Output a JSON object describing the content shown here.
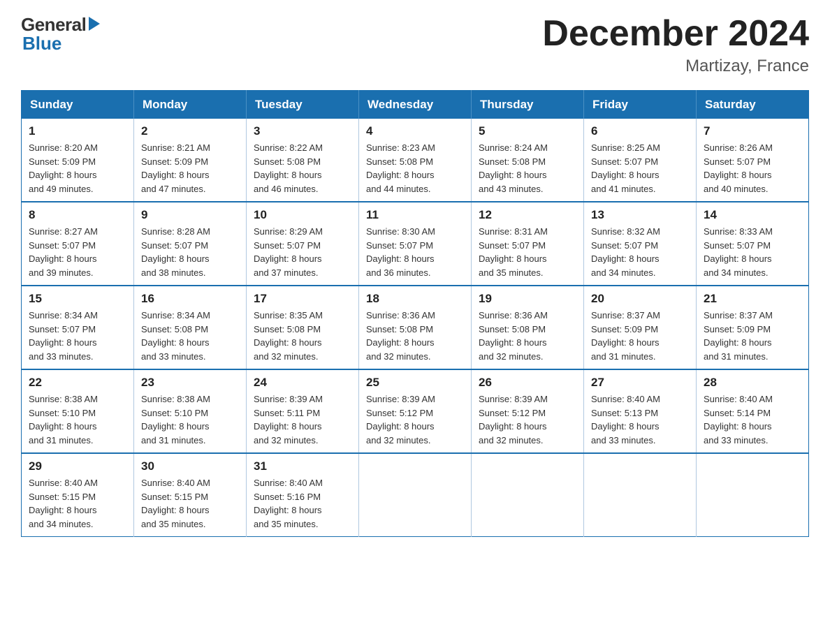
{
  "logo": {
    "general": "General",
    "blue": "Blue"
  },
  "title": "December 2024",
  "subtitle": "Martizay, France",
  "headers": [
    "Sunday",
    "Monday",
    "Tuesday",
    "Wednesday",
    "Thursday",
    "Friday",
    "Saturday"
  ],
  "weeks": [
    [
      {
        "day": "1",
        "sunrise": "8:20 AM",
        "sunset": "5:09 PM",
        "daylight": "8 hours and 49 minutes."
      },
      {
        "day": "2",
        "sunrise": "8:21 AM",
        "sunset": "5:09 PM",
        "daylight": "8 hours and 47 minutes."
      },
      {
        "day": "3",
        "sunrise": "8:22 AM",
        "sunset": "5:08 PM",
        "daylight": "8 hours and 46 minutes."
      },
      {
        "day": "4",
        "sunrise": "8:23 AM",
        "sunset": "5:08 PM",
        "daylight": "8 hours and 44 minutes."
      },
      {
        "day": "5",
        "sunrise": "8:24 AM",
        "sunset": "5:08 PM",
        "daylight": "8 hours and 43 minutes."
      },
      {
        "day": "6",
        "sunrise": "8:25 AM",
        "sunset": "5:07 PM",
        "daylight": "8 hours and 41 minutes."
      },
      {
        "day": "7",
        "sunrise": "8:26 AM",
        "sunset": "5:07 PM",
        "daylight": "8 hours and 40 minutes."
      }
    ],
    [
      {
        "day": "8",
        "sunrise": "8:27 AM",
        "sunset": "5:07 PM",
        "daylight": "8 hours and 39 minutes."
      },
      {
        "day": "9",
        "sunrise": "8:28 AM",
        "sunset": "5:07 PM",
        "daylight": "8 hours and 38 minutes."
      },
      {
        "day": "10",
        "sunrise": "8:29 AM",
        "sunset": "5:07 PM",
        "daylight": "8 hours and 37 minutes."
      },
      {
        "day": "11",
        "sunrise": "8:30 AM",
        "sunset": "5:07 PM",
        "daylight": "8 hours and 36 minutes."
      },
      {
        "day": "12",
        "sunrise": "8:31 AM",
        "sunset": "5:07 PM",
        "daylight": "8 hours and 35 minutes."
      },
      {
        "day": "13",
        "sunrise": "8:32 AM",
        "sunset": "5:07 PM",
        "daylight": "8 hours and 34 minutes."
      },
      {
        "day": "14",
        "sunrise": "8:33 AM",
        "sunset": "5:07 PM",
        "daylight": "8 hours and 34 minutes."
      }
    ],
    [
      {
        "day": "15",
        "sunrise": "8:34 AM",
        "sunset": "5:07 PM",
        "daylight": "8 hours and 33 minutes."
      },
      {
        "day": "16",
        "sunrise": "8:34 AM",
        "sunset": "5:08 PM",
        "daylight": "8 hours and 33 minutes."
      },
      {
        "day": "17",
        "sunrise": "8:35 AM",
        "sunset": "5:08 PM",
        "daylight": "8 hours and 32 minutes."
      },
      {
        "day": "18",
        "sunrise": "8:36 AM",
        "sunset": "5:08 PM",
        "daylight": "8 hours and 32 minutes."
      },
      {
        "day": "19",
        "sunrise": "8:36 AM",
        "sunset": "5:08 PM",
        "daylight": "8 hours and 32 minutes."
      },
      {
        "day": "20",
        "sunrise": "8:37 AM",
        "sunset": "5:09 PM",
        "daylight": "8 hours and 31 minutes."
      },
      {
        "day": "21",
        "sunrise": "8:37 AM",
        "sunset": "5:09 PM",
        "daylight": "8 hours and 31 minutes."
      }
    ],
    [
      {
        "day": "22",
        "sunrise": "8:38 AM",
        "sunset": "5:10 PM",
        "daylight": "8 hours and 31 minutes."
      },
      {
        "day": "23",
        "sunrise": "8:38 AM",
        "sunset": "5:10 PM",
        "daylight": "8 hours and 31 minutes."
      },
      {
        "day": "24",
        "sunrise": "8:39 AM",
        "sunset": "5:11 PM",
        "daylight": "8 hours and 32 minutes."
      },
      {
        "day": "25",
        "sunrise": "8:39 AM",
        "sunset": "5:12 PM",
        "daylight": "8 hours and 32 minutes."
      },
      {
        "day": "26",
        "sunrise": "8:39 AM",
        "sunset": "5:12 PM",
        "daylight": "8 hours and 32 minutes."
      },
      {
        "day": "27",
        "sunrise": "8:40 AM",
        "sunset": "5:13 PM",
        "daylight": "8 hours and 33 minutes."
      },
      {
        "day": "28",
        "sunrise": "8:40 AM",
        "sunset": "5:14 PM",
        "daylight": "8 hours and 33 minutes."
      }
    ],
    [
      {
        "day": "29",
        "sunrise": "8:40 AM",
        "sunset": "5:15 PM",
        "daylight": "8 hours and 34 minutes."
      },
      {
        "day": "30",
        "sunrise": "8:40 AM",
        "sunset": "5:15 PM",
        "daylight": "8 hours and 35 minutes."
      },
      {
        "day": "31",
        "sunrise": "8:40 AM",
        "sunset": "5:16 PM",
        "daylight": "8 hours and 35 minutes."
      },
      null,
      null,
      null,
      null
    ]
  ],
  "labels": {
    "sunrise": "Sunrise:",
    "sunset": "Sunset:",
    "daylight": "Daylight:"
  }
}
